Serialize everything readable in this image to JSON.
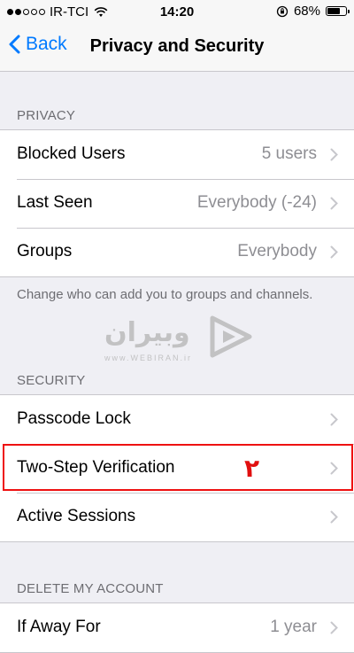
{
  "status_bar": {
    "carrier": "IR-TCI",
    "time": "14:20",
    "battery": "68%",
    "signal_bars_filled": 2,
    "signal_bars_total": 5
  },
  "nav": {
    "back_label": "Back",
    "title": "Privacy and Security"
  },
  "privacy": {
    "header": "PRIVACY",
    "rows": [
      {
        "label": "Blocked Users",
        "value": "5 users"
      },
      {
        "label": "Last Seen",
        "value": "Everybody (-24)"
      },
      {
        "label": "Groups",
        "value": "Everybody"
      }
    ],
    "footer": "Change who can add you to groups and channels."
  },
  "watermark": {
    "brand": "وبیران",
    "site": "www.WEBIRAN.ir"
  },
  "security": {
    "header": "SECURITY",
    "rows": [
      {
        "label": "Passcode Lock",
        "value": ""
      },
      {
        "label": "Two-Step Verification",
        "value": ""
      },
      {
        "label": "Active Sessions",
        "value": ""
      }
    ]
  },
  "annotation": {
    "step_number": "۲",
    "color": "#e10f0f"
  },
  "delete_account": {
    "header": "DELETE MY ACCOUNT",
    "rows": [
      {
        "label": "If Away For",
        "value": "1 year"
      }
    ]
  },
  "colors": {
    "accent": "#007aff",
    "background": "#efeff4",
    "secondary_text": "#8e8e93"
  }
}
